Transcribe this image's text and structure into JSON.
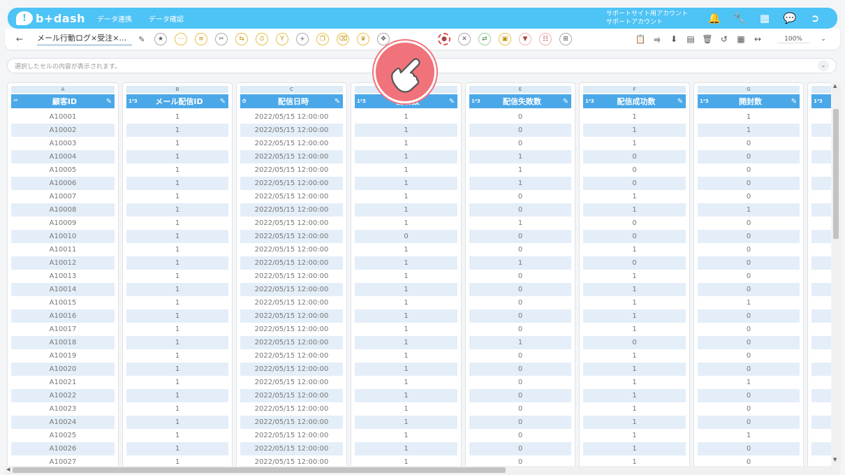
{
  "app": {
    "name": "b+dash"
  },
  "nav": [
    "データ連携",
    "データ確認"
  ],
  "account": {
    "line1": "サポートサイト用アカウント",
    "line2": "サポートアカウント"
  },
  "toolbar": {
    "sheet_name": "メール行動ログ×受注×…",
    "zoom": "100%"
  },
  "formula_bar": {
    "placeholder": "選択したセルの内容が表示されます。"
  },
  "icons": {
    "top": [
      "bell-icon",
      "wrench-icon",
      "grid-apps-icon",
      "chat-bot-icon",
      "logout-icon"
    ],
    "tools": [
      "star-icon",
      "more-icon",
      "note-icon",
      "scissors-icon",
      "shuffle-icon",
      "timer-icon",
      "merge-icon",
      "plus-icon",
      "copy-icon",
      "trash-icon",
      "crown-icon",
      "expand-icon",
      "blank-icon",
      "paint-bucket-icon",
      "close-circle-icon",
      "swap-icon",
      "box-icon",
      "filter-icon",
      "calendar-grid-icon",
      "table-icon"
    ],
    "right": [
      "clipboard-icon",
      "share-icon",
      "download-icon",
      "sheet-icon",
      "delete-icon",
      "history-icon",
      "save-icon",
      "code-icon"
    ]
  },
  "columns": [
    {
      "letter": "A",
      "name": "顧客ID",
      "type": "abc"
    },
    {
      "letter": "B",
      "name": "メール配信ID",
      "type": "123"
    },
    {
      "letter": "C",
      "name": "配信日時",
      "type": "time"
    },
    {
      "letter": "D",
      "name": "配信数",
      "type": "123"
    },
    {
      "letter": "E",
      "name": "配信失敗数",
      "type": "123"
    },
    {
      "letter": "F",
      "name": "配信成功数",
      "type": "123"
    },
    {
      "letter": "G",
      "name": "開封数",
      "type": "123"
    },
    {
      "letter": "",
      "name": "",
      "type": "123"
    }
  ],
  "rows": [
    [
      "A10001",
      "1",
      "2022/05/15 12:00:00",
      "1",
      "0",
      "1",
      "1"
    ],
    [
      "A10002",
      "1",
      "2022/05/15 12:00:00",
      "1",
      "0",
      "1",
      "1"
    ],
    [
      "A10003",
      "1",
      "2022/05/15 12:00:00",
      "1",
      "0",
      "1",
      "0"
    ],
    [
      "A10004",
      "1",
      "2022/05/15 12:00:00",
      "1",
      "1",
      "0",
      "0"
    ],
    [
      "A10005",
      "1",
      "2022/05/15 12:00:00",
      "1",
      "1",
      "0",
      "0"
    ],
    [
      "A10006",
      "1",
      "2022/05/15 12:00:00",
      "1",
      "1",
      "0",
      "0"
    ],
    [
      "A10007",
      "1",
      "2022/05/15 12:00:00",
      "1",
      "0",
      "1",
      "0"
    ],
    [
      "A10008",
      "1",
      "2022/05/15 12:00:00",
      "1",
      "0",
      "1",
      "1"
    ],
    [
      "A10009",
      "1",
      "2022/05/15 12:00:00",
      "1",
      "1",
      "0",
      "0"
    ],
    [
      "A10010",
      "1",
      "2022/05/15 12:00:00",
      "0",
      "0",
      "0",
      "0"
    ],
    [
      "A10011",
      "1",
      "2022/05/15 12:00:00",
      "1",
      "0",
      "1",
      "0"
    ],
    [
      "A10012",
      "1",
      "2022/05/15 12:00:00",
      "1",
      "1",
      "0",
      "0"
    ],
    [
      "A10013",
      "1",
      "2022/05/15 12:00:00",
      "1",
      "0",
      "1",
      "0"
    ],
    [
      "A10014",
      "1",
      "2022/05/15 12:00:00",
      "1",
      "0",
      "1",
      "0"
    ],
    [
      "A10015",
      "1",
      "2022/05/15 12:00:00",
      "1",
      "0",
      "1",
      "1"
    ],
    [
      "A10016",
      "1",
      "2022/05/15 12:00:00",
      "1",
      "0",
      "1",
      "0"
    ],
    [
      "A10017",
      "1",
      "2022/05/15 12:00:00",
      "1",
      "0",
      "1",
      "0"
    ],
    [
      "A10018",
      "1",
      "2022/05/15 12:00:00",
      "1",
      "1",
      "0",
      "0"
    ],
    [
      "A10019",
      "1",
      "2022/05/15 12:00:00",
      "1",
      "0",
      "1",
      "0"
    ],
    [
      "A10020",
      "1",
      "2022/05/15 12:00:00",
      "1",
      "0",
      "1",
      "0"
    ],
    [
      "A10021",
      "1",
      "2022/05/15 12:00:00",
      "1",
      "0",
      "1",
      "1"
    ],
    [
      "A10022",
      "1",
      "2022/05/15 12:00:00",
      "1",
      "0",
      "1",
      "0"
    ],
    [
      "A10023",
      "1",
      "2022/05/15 12:00:00",
      "1",
      "0",
      "1",
      "0"
    ],
    [
      "A10024",
      "1",
      "2022/05/15 12:00:00",
      "1",
      "0",
      "1",
      "0"
    ],
    [
      "A10025",
      "1",
      "2022/05/15 12:00:00",
      "1",
      "0",
      "1",
      "1"
    ],
    [
      "A10026",
      "1",
      "2022/05/15 12:00:00",
      "1",
      "0",
      "1",
      "0"
    ],
    [
      "A10027",
      "1",
      "2022/05/15 12:00:00",
      "1",
      "0",
      "1",
      "0"
    ]
  ]
}
